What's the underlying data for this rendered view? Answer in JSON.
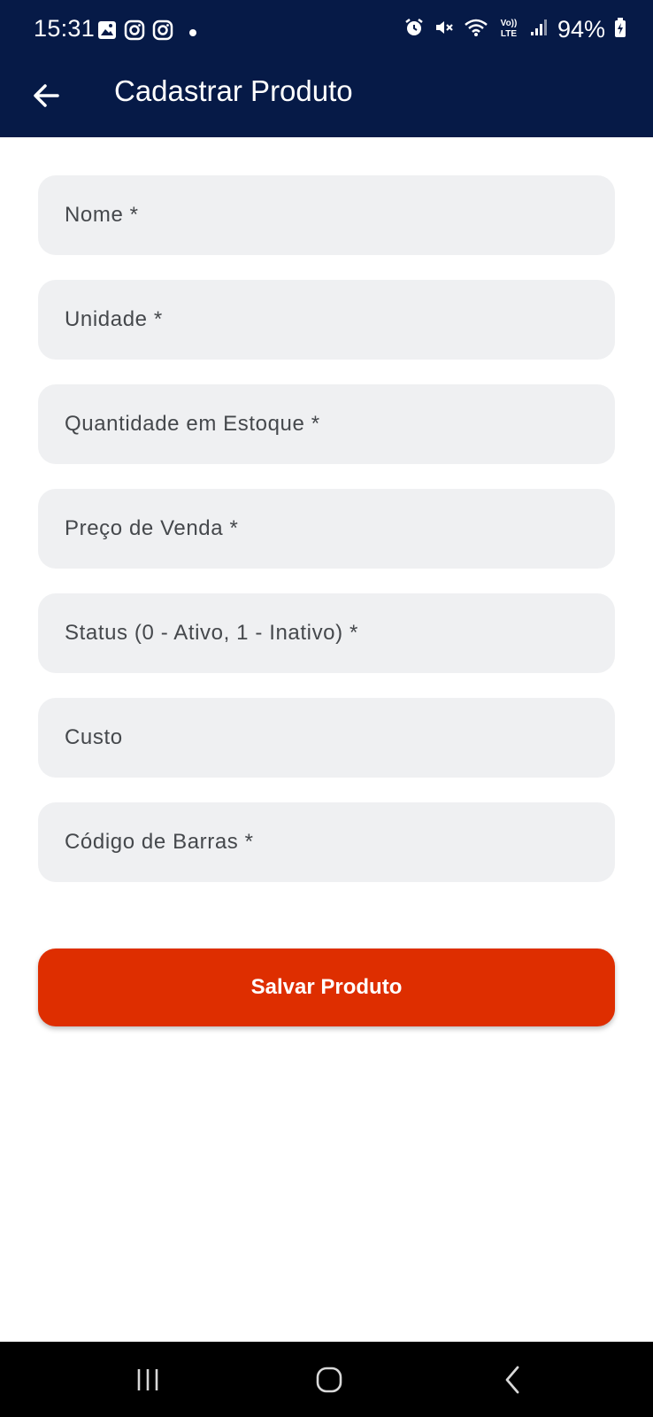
{
  "status_bar": {
    "time": "15:31",
    "battery": "94%",
    "left_icons": [
      "gallery-icon",
      "instagram-icon",
      "instagram-icon",
      "notification-dot-icon"
    ],
    "right_icons": [
      "alarm-icon",
      "mute-icon",
      "wifi-icon",
      "volte-icon",
      "signal-icon",
      "battery-charging-icon"
    ]
  },
  "app_bar": {
    "title": "Cadastrar Produto",
    "back_icon": "arrow-back-icon"
  },
  "form": {
    "fields": [
      {
        "placeholder": "Nome *",
        "value": ""
      },
      {
        "placeholder": "Unidade *",
        "value": ""
      },
      {
        "placeholder": "Quantidade em Estoque *",
        "value": ""
      },
      {
        "placeholder": "Preço de Venda *",
        "value": ""
      },
      {
        "placeholder": "Status (0 - Ativo, 1 - Inativo) *",
        "value": ""
      },
      {
        "placeholder": "Custo",
        "value": ""
      },
      {
        "placeholder": "Código de Barras *",
        "value": ""
      }
    ],
    "submit_label": "Salvar Produto"
  },
  "nav_bar": {
    "icons": [
      "recent-apps-icon",
      "home-icon",
      "back-icon"
    ]
  },
  "colors": {
    "app_bar_bg": "#061a47",
    "field_bg": "#eff0f2",
    "primary_button": "#de2e00",
    "nav_bar_bg": "#000000"
  }
}
